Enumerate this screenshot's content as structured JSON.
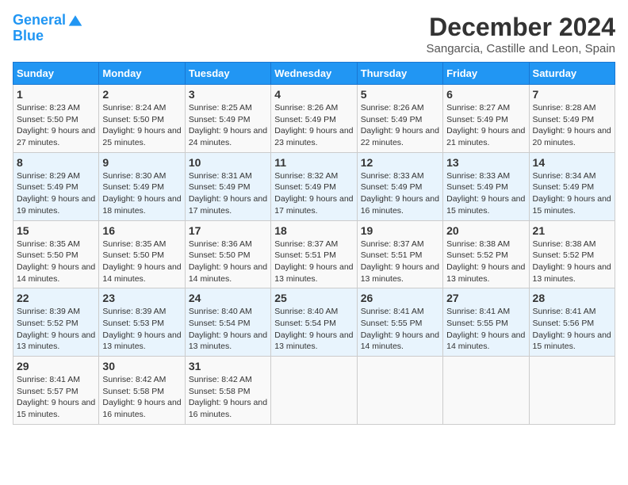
{
  "header": {
    "logo_line1": "General",
    "logo_line2": "Blue",
    "month_title": "December 2024",
    "location": "Sangarcia, Castille and Leon, Spain"
  },
  "weekdays": [
    "Sunday",
    "Monday",
    "Tuesday",
    "Wednesday",
    "Thursday",
    "Friday",
    "Saturday"
  ],
  "weeks": [
    [
      {
        "day": "1",
        "sunrise": "8:23 AM",
        "sunset": "5:50 PM",
        "daylight": "9 hours and 27 minutes."
      },
      {
        "day": "2",
        "sunrise": "8:24 AM",
        "sunset": "5:50 PM",
        "daylight": "9 hours and 25 minutes."
      },
      {
        "day": "3",
        "sunrise": "8:25 AM",
        "sunset": "5:49 PM",
        "daylight": "9 hours and 24 minutes."
      },
      {
        "day": "4",
        "sunrise": "8:26 AM",
        "sunset": "5:49 PM",
        "daylight": "9 hours and 23 minutes."
      },
      {
        "day": "5",
        "sunrise": "8:26 AM",
        "sunset": "5:49 PM",
        "daylight": "9 hours and 22 minutes."
      },
      {
        "day": "6",
        "sunrise": "8:27 AM",
        "sunset": "5:49 PM",
        "daylight": "9 hours and 21 minutes."
      },
      {
        "day": "7",
        "sunrise": "8:28 AM",
        "sunset": "5:49 PM",
        "daylight": "9 hours and 20 minutes."
      }
    ],
    [
      {
        "day": "8",
        "sunrise": "8:29 AM",
        "sunset": "5:49 PM",
        "daylight": "9 hours and 19 minutes."
      },
      {
        "day": "9",
        "sunrise": "8:30 AM",
        "sunset": "5:49 PM",
        "daylight": "9 hours and 18 minutes."
      },
      {
        "day": "10",
        "sunrise": "8:31 AM",
        "sunset": "5:49 PM",
        "daylight": "9 hours and 17 minutes."
      },
      {
        "day": "11",
        "sunrise": "8:32 AM",
        "sunset": "5:49 PM",
        "daylight": "9 hours and 17 minutes."
      },
      {
        "day": "12",
        "sunrise": "8:33 AM",
        "sunset": "5:49 PM",
        "daylight": "9 hours and 16 minutes."
      },
      {
        "day": "13",
        "sunrise": "8:33 AM",
        "sunset": "5:49 PM",
        "daylight": "9 hours and 15 minutes."
      },
      {
        "day": "14",
        "sunrise": "8:34 AM",
        "sunset": "5:49 PM",
        "daylight": "9 hours and 15 minutes."
      }
    ],
    [
      {
        "day": "15",
        "sunrise": "8:35 AM",
        "sunset": "5:50 PM",
        "daylight": "9 hours and 14 minutes."
      },
      {
        "day": "16",
        "sunrise": "8:35 AM",
        "sunset": "5:50 PM",
        "daylight": "9 hours and 14 minutes."
      },
      {
        "day": "17",
        "sunrise": "8:36 AM",
        "sunset": "5:50 PM",
        "daylight": "9 hours and 14 minutes."
      },
      {
        "day": "18",
        "sunrise": "8:37 AM",
        "sunset": "5:51 PM",
        "daylight": "9 hours and 13 minutes."
      },
      {
        "day": "19",
        "sunrise": "8:37 AM",
        "sunset": "5:51 PM",
        "daylight": "9 hours and 13 minutes."
      },
      {
        "day": "20",
        "sunrise": "8:38 AM",
        "sunset": "5:52 PM",
        "daylight": "9 hours and 13 minutes."
      },
      {
        "day": "21",
        "sunrise": "8:38 AM",
        "sunset": "5:52 PM",
        "daylight": "9 hours and 13 minutes."
      }
    ],
    [
      {
        "day": "22",
        "sunrise": "8:39 AM",
        "sunset": "5:52 PM",
        "daylight": "9 hours and 13 minutes."
      },
      {
        "day": "23",
        "sunrise": "8:39 AM",
        "sunset": "5:53 PM",
        "daylight": "9 hours and 13 minutes."
      },
      {
        "day": "24",
        "sunrise": "8:40 AM",
        "sunset": "5:54 PM",
        "daylight": "9 hours and 13 minutes."
      },
      {
        "day": "25",
        "sunrise": "8:40 AM",
        "sunset": "5:54 PM",
        "daylight": "9 hours and 13 minutes."
      },
      {
        "day": "26",
        "sunrise": "8:41 AM",
        "sunset": "5:55 PM",
        "daylight": "9 hours and 14 minutes."
      },
      {
        "day": "27",
        "sunrise": "8:41 AM",
        "sunset": "5:55 PM",
        "daylight": "9 hours and 14 minutes."
      },
      {
        "day": "28",
        "sunrise": "8:41 AM",
        "sunset": "5:56 PM",
        "daylight": "9 hours and 15 minutes."
      }
    ],
    [
      {
        "day": "29",
        "sunrise": "8:41 AM",
        "sunset": "5:57 PM",
        "daylight": "9 hours and 15 minutes."
      },
      {
        "day": "30",
        "sunrise": "8:42 AM",
        "sunset": "5:58 PM",
        "daylight": "9 hours and 16 minutes."
      },
      {
        "day": "31",
        "sunrise": "8:42 AM",
        "sunset": "5:58 PM",
        "daylight": "9 hours and 16 minutes."
      },
      null,
      null,
      null,
      null
    ]
  ],
  "labels": {
    "sunrise": "Sunrise:",
    "sunset": "Sunset:",
    "daylight": "Daylight:"
  }
}
